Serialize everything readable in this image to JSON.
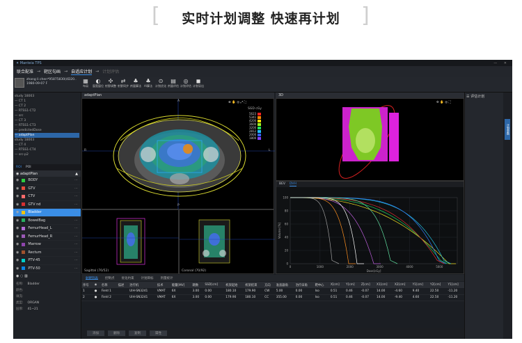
{
  "header": {
    "left_bracket": "[",
    "title": "实时计划调整 快速再计划",
    "right_bracket": "]"
  },
  "app": {
    "title": "Manteia TPS",
    "window_controls": "— ✕",
    "steps": [
      "联合配准",
      "靶区勾画",
      "自适应计划",
      "计划评估"
    ],
    "patient": {
      "name": "zhang li chen*95875830(4D20..",
      "dob": "1980-09-07  F"
    },
    "ribbon": [
      {
        "icon": "▦",
        "label": "布局"
      },
      {
        "icon": "◐",
        "label": "窗宽窗位"
      },
      {
        "icon": "✣",
        "label": "射野调整"
      },
      {
        "icon": "⇄",
        "label": "射野同步"
      },
      {
        "icon": "♣",
        "label": "剂量算法"
      },
      {
        "icon": "♣",
        "label": "AI算法"
      },
      {
        "icon": "⊙",
        "label": "计划优化"
      },
      {
        "icon": "▤",
        "label": "剂量评估"
      },
      {
        "icon": "◎",
        "label": "计划评估"
      },
      {
        "icon": "◼",
        "label": "计划导出"
      }
    ],
    "tree": [
      "study 18003",
      "— CT 1",
      "— CT 2",
      "— RTSS1-CT2",
      "— src",
      "— CT 3",
      "— RTSS1-CT3",
      "— predictedDose",
      "— adaptPlan",
      "study 18003",
      "— CT 4",
      "— RTSS1-CT4",
      "— src-p2"
    ],
    "tree_selected": "— adaptPlan",
    "left_tabs": [
      "ROI",
      "POI"
    ],
    "plan_name": "adaptPlan",
    "rois": [
      {
        "name": "BODY",
        "color": "#2ecc40"
      },
      {
        "name": "GTV",
        "color": "#e74c3c"
      },
      {
        "name": "CTV",
        "color": "#ff6b6b"
      },
      {
        "name": "GTV nd",
        "color": "#d63031"
      },
      {
        "name": "Bladder",
        "color": "#f1c40f"
      },
      {
        "name": "BowelBag",
        "color": "#27ae60"
      },
      {
        "name": "FemurHead_L",
        "color": "#b36bd6"
      },
      {
        "name": "FemurHead_R",
        "color": "#9b59b6"
      },
      {
        "name": "Marrow",
        "color": "#8e44ad"
      },
      {
        "name": "Rectum",
        "color": "#a0522d"
      },
      {
        "name": "PTV-45",
        "color": "#00cec9"
      },
      {
        "name": "PTV-50",
        "color": "#0984e3"
      }
    ],
    "roi_selected": "Bladder",
    "props": [
      {
        "k": "名称:",
        "v": "Bladder"
      },
      {
        "k": "颜色:",
        "v": ""
      },
      {
        "k": "填充:",
        "v": ""
      },
      {
        "k": "类型:",
        "v": "ORGAN"
      },
      {
        "k": "层厚:",
        "v": "41~21"
      }
    ],
    "views": {
      "axial_title": "adaptPlan",
      "v3d_title": "3D",
      "sag_title": "Sagittal (70/52)",
      "cor_title": "Coronal (70/92)",
      "ax_top": "A",
      "ax_right": "L",
      "ax_left": "R",
      "ax_bottom": "P",
      "dose_unit": "SGD cGy",
      "dose_levels": [
        "5623",
        "5341",
        "4200",
        "3600",
        "3200",
        "2812",
        "2000",
        "1800"
      ]
    },
    "dvh": {
      "tabs": [
        "BEV",
        "DVH"
      ],
      "ylabel": "Volume [%]",
      "xlabel": "Dose[cGy]",
      "xticks": [
        "0",
        "1000",
        "2000",
        "3000",
        "4000",
        "5000"
      ],
      "yticks": [
        "0",
        "20",
        "40",
        "60",
        "80",
        "100"
      ]
    },
    "beam_tabs": [
      "射野列表",
      "控制点",
      "优化约束",
      "计划目标",
      "剂量统计"
    ],
    "beam_cols": [
      "序号",
      "◉",
      "名称",
      "描述",
      "治疗机",
      "技术",
      "能量[MV]",
      "跳数",
      "SSD[cm]",
      "机架起始",
      "机架结束",
      "方向",
      "准直器角",
      "治疗床角",
      "靶中心",
      "X[cm]",
      "Y[cm]",
      "Z[cm]",
      "X1[cm]",
      "X2[cm]",
      "Y1[cm]",
      "Y2[cm]",
      "Y1[cm]"
    ],
    "beams": [
      [
        "1",
        "●",
        "Field 1",
        "",
        "UIH-SN3241",
        "VMAT",
        "6X",
        "3.00",
        "0.00",
        "180.10",
        "179.90",
        "CW",
        "5.00",
        "0.00",
        "Iso",
        "0.51",
        "0.46",
        "-0.07",
        "14.00",
        "-4.60",
        "9.40",
        "22.50",
        "-11.20"
      ],
      [
        "2",
        "●",
        "Field 2",
        "",
        "UIH-SN3241",
        "VMAT",
        "6X",
        "3.00",
        "0.00",
        "179.90",
        "180.10",
        "CC",
        "355.00",
        "0.00",
        "Iso",
        "0.51",
        "0.46",
        "-0.07",
        "14.00",
        "-9.40",
        "4.60",
        "22.50",
        "-11.20"
      ]
    ],
    "bottom_buttons": [
      "添加",
      "删除",
      "复制",
      "属性"
    ],
    "right_title": "☰ 评估计划",
    "right_tab": "计划参数"
  }
}
